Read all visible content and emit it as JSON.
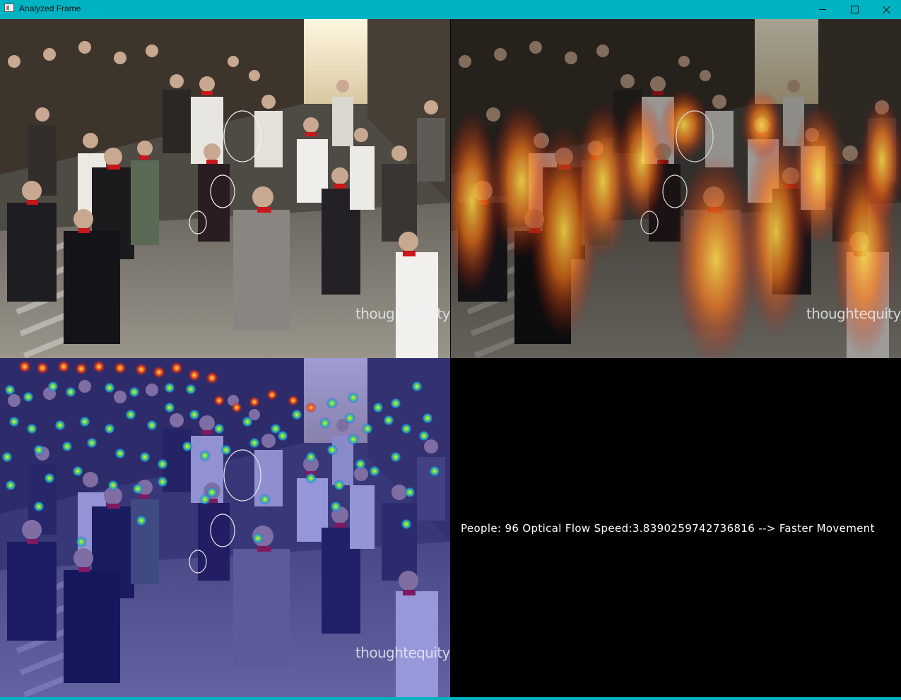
{
  "window": {
    "title": "Analyzed Frame",
    "controls": {
      "minimize": "minimize-icon",
      "maximize": "maximize-icon",
      "close": "close-icon"
    }
  },
  "panels": {
    "top_left": {
      "name": "original-frame",
      "watermark": "thoughtequity"
    },
    "top_right": {
      "name": "motion-heatmap-overlay",
      "watermark": "thoughtequity"
    },
    "bottom_left": {
      "name": "head-detection-density-overlay",
      "watermark": "thoughtequity"
    },
    "bottom_right": {
      "name": "analysis-output"
    }
  },
  "analysis": {
    "status_line": "People: 96 Optical Flow Speed:3.8390259742736816 --> Faster Movement"
  },
  "colors": {
    "titlebar": "#00b3c2",
    "heat_hot": "#ffdd33",
    "heat_mid": "#e8331a",
    "density_cool": "#2a2aa8",
    "density_hot": "#ff3a1a"
  }
}
